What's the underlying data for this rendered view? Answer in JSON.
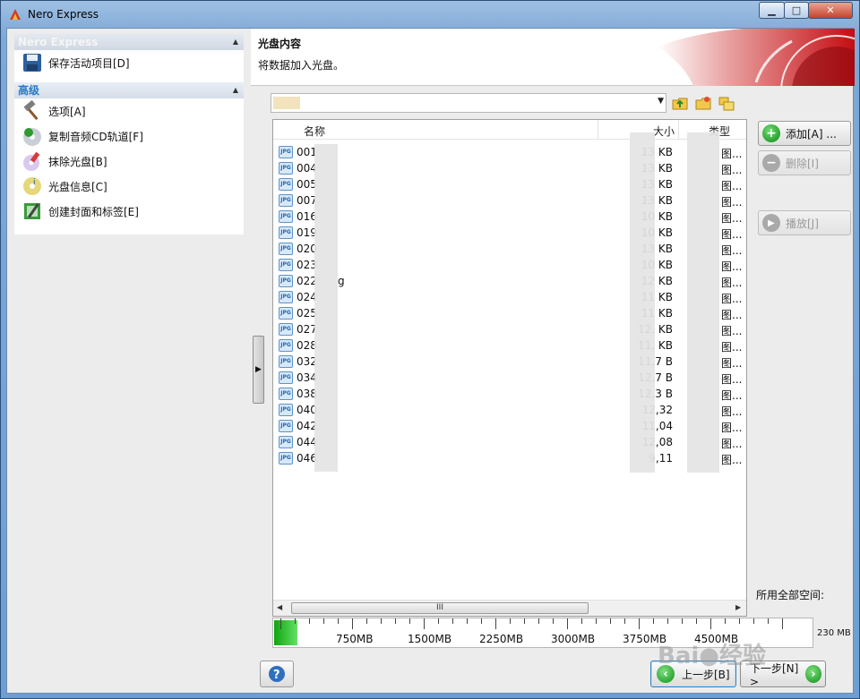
{
  "window": {
    "title": "Nero Express",
    "min_label": "▁",
    "max_label": "□",
    "close_label": "✕"
  },
  "left_panel": {
    "sections": [
      {
        "title": "Nero Express",
        "items": [
          {
            "label": "保存活动项目[D]",
            "icon": "save-icon"
          }
        ]
      },
      {
        "title": "高级",
        "items": [
          {
            "label": "选项[A]",
            "icon": "hammer-icon"
          },
          {
            "label": "复制音频CD轨道[F]",
            "icon": "audio-cd-icon"
          },
          {
            "label": "抹除光盘[B]",
            "icon": "erase-disc-icon"
          },
          {
            "label": "光盘信息[C]",
            "icon": "disc-info-icon"
          },
          {
            "label": "创建封面和标签[E]",
            "icon": "cover-label-icon"
          }
        ]
      }
    ]
  },
  "header": {
    "title": "光盘内容",
    "subtitle": "将数据加入光盘。"
  },
  "path_bar": {
    "text": ""
  },
  "file_list": {
    "columns": {
      "name": "名称",
      "size": "大小",
      "type": "类型"
    },
    "rows": [
      {
        "name": "001",
        "size": "13",
        "type": "图...",
        "kb": "KB"
      },
      {
        "name": "004",
        "size": "13",
        "type": "图...",
        "kb": "KB"
      },
      {
        "name": "005",
        "size": "13",
        "type": "图...",
        "kb": "KB"
      },
      {
        "name": "007",
        "size": "13",
        "type": "图...",
        "kb": "KB"
      },
      {
        "name": "016",
        "size": "10",
        "type": "图...",
        "kb": "KB"
      },
      {
        "name": "019",
        "size": "10",
        "type": "图...",
        "kb": "KB"
      },
      {
        "name": "020",
        "size": "13",
        "type": "图...",
        "kb": "KB"
      },
      {
        "name": "023",
        "size": "10",
        "type": "图...",
        "kb": "KB"
      },
      {
        "name": "022",
        "size": "12",
        "type": "图...",
        "kb": "KB"
      },
      {
        "name": "024",
        "size": "11",
        "type": "图...",
        "kb": "KB"
      },
      {
        "name": "025",
        "size": "11",
        "type": "图...",
        "kb": "KB"
      },
      {
        "name": "027",
        "size": "12,",
        "type": "图...",
        "kb": "KB"
      },
      {
        "name": "028",
        "size": "11,",
        "type": "图...",
        "kb": "KB"
      },
      {
        "name": "032",
        "size": "11,7",
        "type": "图...",
        "kb": "B"
      },
      {
        "name": "034",
        "size": "12,7",
        "type": "图...",
        "kb": "B"
      },
      {
        "name": "038",
        "size": "12,3",
        "type": "图...",
        "kb": "B"
      },
      {
        "name": "040",
        "size": "12,32",
        "type": "图...",
        "kb": ""
      },
      {
        "name": "042",
        "size": "11,04",
        "type": "图...",
        "kb": ""
      },
      {
        "name": "044",
        "size": "12,08",
        "type": "图...",
        "kb": ""
      },
      {
        "name": "046",
        "size": "9,11",
        "type": "图...",
        "kb": ""
      }
    ],
    "row_022_suffix": "g",
    "scroll_grip": "III"
  },
  "side_buttons": {
    "add": "添加[A] ...",
    "delete": "删除[I]",
    "play": "播放[J]"
  },
  "space": {
    "label": "所用全部空间:",
    "used_fraction": 0.04,
    "ticks": [
      "750MB",
      "1500MB",
      "2250MB",
      "3000MB",
      "3750MB",
      "4500MB"
    ],
    "max_label": "230 MB"
  },
  "nav": {
    "back": "上一步[B]",
    "next": "下一步[N] >"
  },
  "watermark": "Bai●经验"
}
